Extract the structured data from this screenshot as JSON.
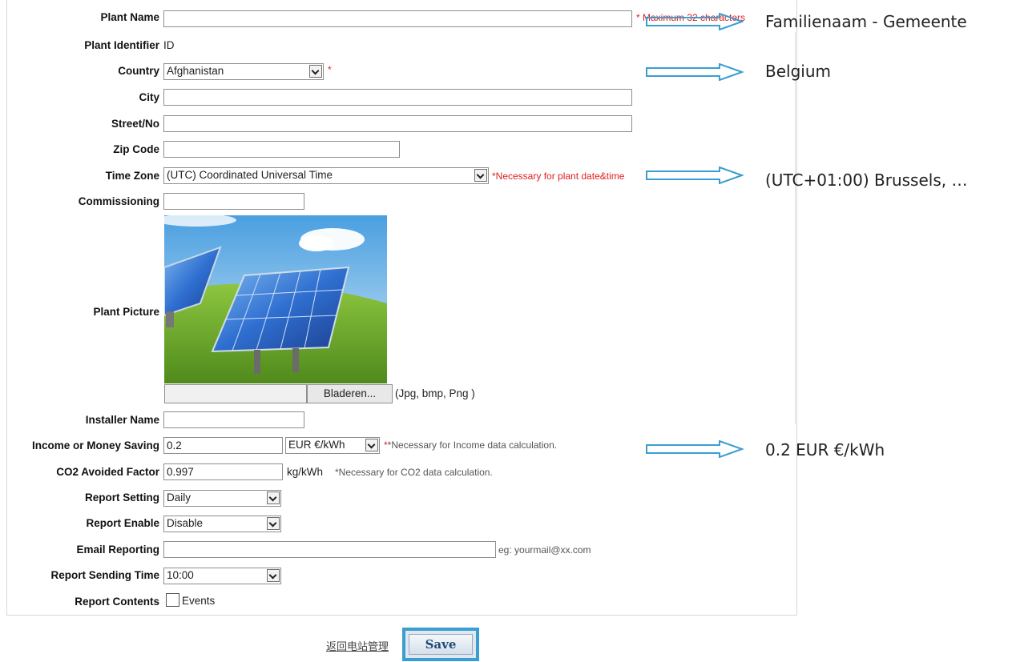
{
  "form": {
    "plant_name": {
      "label": "Plant Name",
      "value": "",
      "note": "* Maximum 32 characters"
    },
    "plant_identifier": {
      "label": "Plant Identifier",
      "value": "ID"
    },
    "country": {
      "label": "Country",
      "value": "Afghanistan",
      "req": "*"
    },
    "city": {
      "label": "City",
      "value": ""
    },
    "street": {
      "label": "Street/No",
      "value": ""
    },
    "zip": {
      "label": "Zip Code",
      "value": ""
    },
    "time_zone": {
      "label": "Time Zone",
      "value": "(UTC) Coordinated Universal Time",
      "note": "*Necessary for plant date&time"
    },
    "commissioning": {
      "label": "Commissioning",
      "value": ""
    },
    "plant_picture": {
      "label": "Plant Picture",
      "browse_label": "Bladeren...",
      "formats": "(Jpg, bmp, Png )"
    },
    "installer": {
      "label": "Installer Name",
      "value": ""
    },
    "income": {
      "label": "Income or Money Saving",
      "value": "0.2",
      "unit": "EUR €/kWh",
      "note": "*Necessary for Income data calculation."
    },
    "co2": {
      "label": "CO2 Avoided Factor",
      "value": "0.997",
      "unit": "kg/kWh",
      "note": "*Necessary for CO2 data calculation."
    },
    "report_setting": {
      "label": "Report Setting",
      "value": "Daily"
    },
    "report_enable": {
      "label": "Report Enable",
      "value": "Disable"
    },
    "email": {
      "label": "Email Reporting",
      "value": "",
      "hint": "eg: yourmail@xx.com"
    },
    "send_time": {
      "label": "Report Sending Time",
      "value": "10:00"
    },
    "contents": {
      "label": "Report Contents",
      "option": "Events",
      "checked": false
    }
  },
  "footer": {
    "back_link": "返回电站管理",
    "save_label": "Save"
  },
  "annotations": {
    "a1": "Familienaam - Gemeente",
    "a2": "Belgium",
    "a3": "(UTC+01:00) Brussels, …",
    "a4": "0.2 EUR €/kWh"
  },
  "colors": {
    "accent": "#3a9fd0",
    "required": "#e02020"
  }
}
